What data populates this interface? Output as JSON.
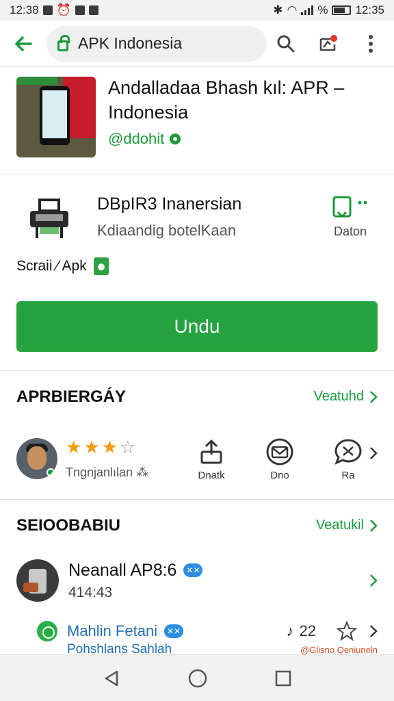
{
  "status_bar": {
    "time_left": "12:38",
    "time_right": "12:35"
  },
  "browser": {
    "url": "APK Indonesia",
    "colors": {
      "accent": "#1a9a3a"
    }
  },
  "app": {
    "title": "Andalladaa Bhash kıl: APR – Indonesia",
    "handle": "@ddohit"
  },
  "package": {
    "name": "DBpIR3 Inanersian",
    "subtitle": "Kdiaandig botelKaan",
    "save_label": "Daton",
    "apk_label": "Scraii ⁄ Apk",
    "download_label": "Undu"
  },
  "section_ratings": {
    "title": "APRBIERGÁY",
    "link": "Veatuhd",
    "reviewer": "Tngnjanlılan ⁂",
    "rating": 3,
    "rating_max": 4,
    "actions": [
      {
        "label": "Dnatk",
        "icon": "share-icon"
      },
      {
        "label": "Dno",
        "icon": "mail-icon"
      },
      {
        "label": "Ra",
        "icon": "chat-icon"
      }
    ]
  },
  "section_list": {
    "title": "SEIOOBABIU",
    "link": "Veatukil",
    "item1": {
      "name": "Neanall AP8:6",
      "tag": "✕✕",
      "sub": "414:43"
    },
    "item2": {
      "name": "Mahlin Fetani",
      "tag": "✕✕",
      "count": "22"
    },
    "item3": {
      "left": "Pohshlans Sahlah",
      "right": "@Glisno Qeniuneln"
    }
  }
}
